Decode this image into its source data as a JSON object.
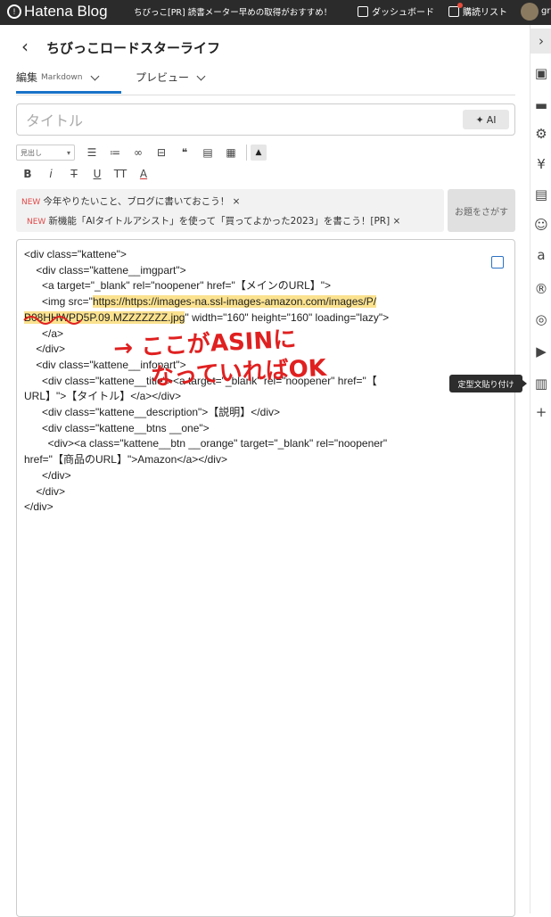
{
  "topbar": {
    "logo": "Hatena Blog",
    "blog_title": "ちびっこ[PR] 読書メーター早めの取得がおすすめ！",
    "dashboard": "ダッシュボード",
    "reading_list": "購読リスト",
    "user": "gr"
  },
  "header": {
    "title": "ちびっこロードスターライフ",
    "tab_edit": "編集",
    "tab_edit_sub": "Markdown",
    "tab_preview": "プレビュー"
  },
  "editor": {
    "title_placeholder": "タイトル",
    "ai_button": "AI",
    "heading_select": "見出し"
  },
  "notices": [
    {
      "badge": "NEW",
      "text": "今年やりたいこと、ブログに書いておこう！ ×"
    },
    {
      "badge": "NEW",
      "text": "新機能「AIタイトルアシスト」を使って「買ってよかった2023」を書こう！[PR] ×"
    }
  ],
  "topic_button": "お題をさがす",
  "code_lines": [
    "<div class=\"kattene\">",
    "    <div class=\"kattene__imgpart\">",
    "      <a target=\"_blank\" rel=\"noopener\" href=\"【メインのURL】\">",
    "      <img src=\"",
    "B08HHWPD5P.09.MZZZZZZZ.jpg",
    "      </a>",
    "    </div>",
    "    <div class=\"kattene__infopart\">",
    "      <div class=\"kattene__title\"><a target=\"_blank\" rel=\"noopener\" href=\"【",
    "URL】\">【タイトル】</a></div>",
    "      <div class=\"kattene__description\">【説明】</div>",
    "      <div class=\"kattene__btns __one\">",
    "        <div><a class=\"kattene__btn __orange\" target=\"_blank\" rel=\"noopener\"",
    "href=\"【商品のURL】\">Amazon</a></div>",
    "      </div>",
    "    </div>",
    "</div>"
  ],
  "code_hl_url": "https://https://images-na.ssl-images-amazon.com/images/P/",
  "code_tail": "\" width=\"160\" height=\"160\" loading=\"lazy\">",
  "annotation_line1": "→ ここがASINに",
  "annotation_line2": "なっていればOK",
  "tooltip": "定型文貼り付け"
}
